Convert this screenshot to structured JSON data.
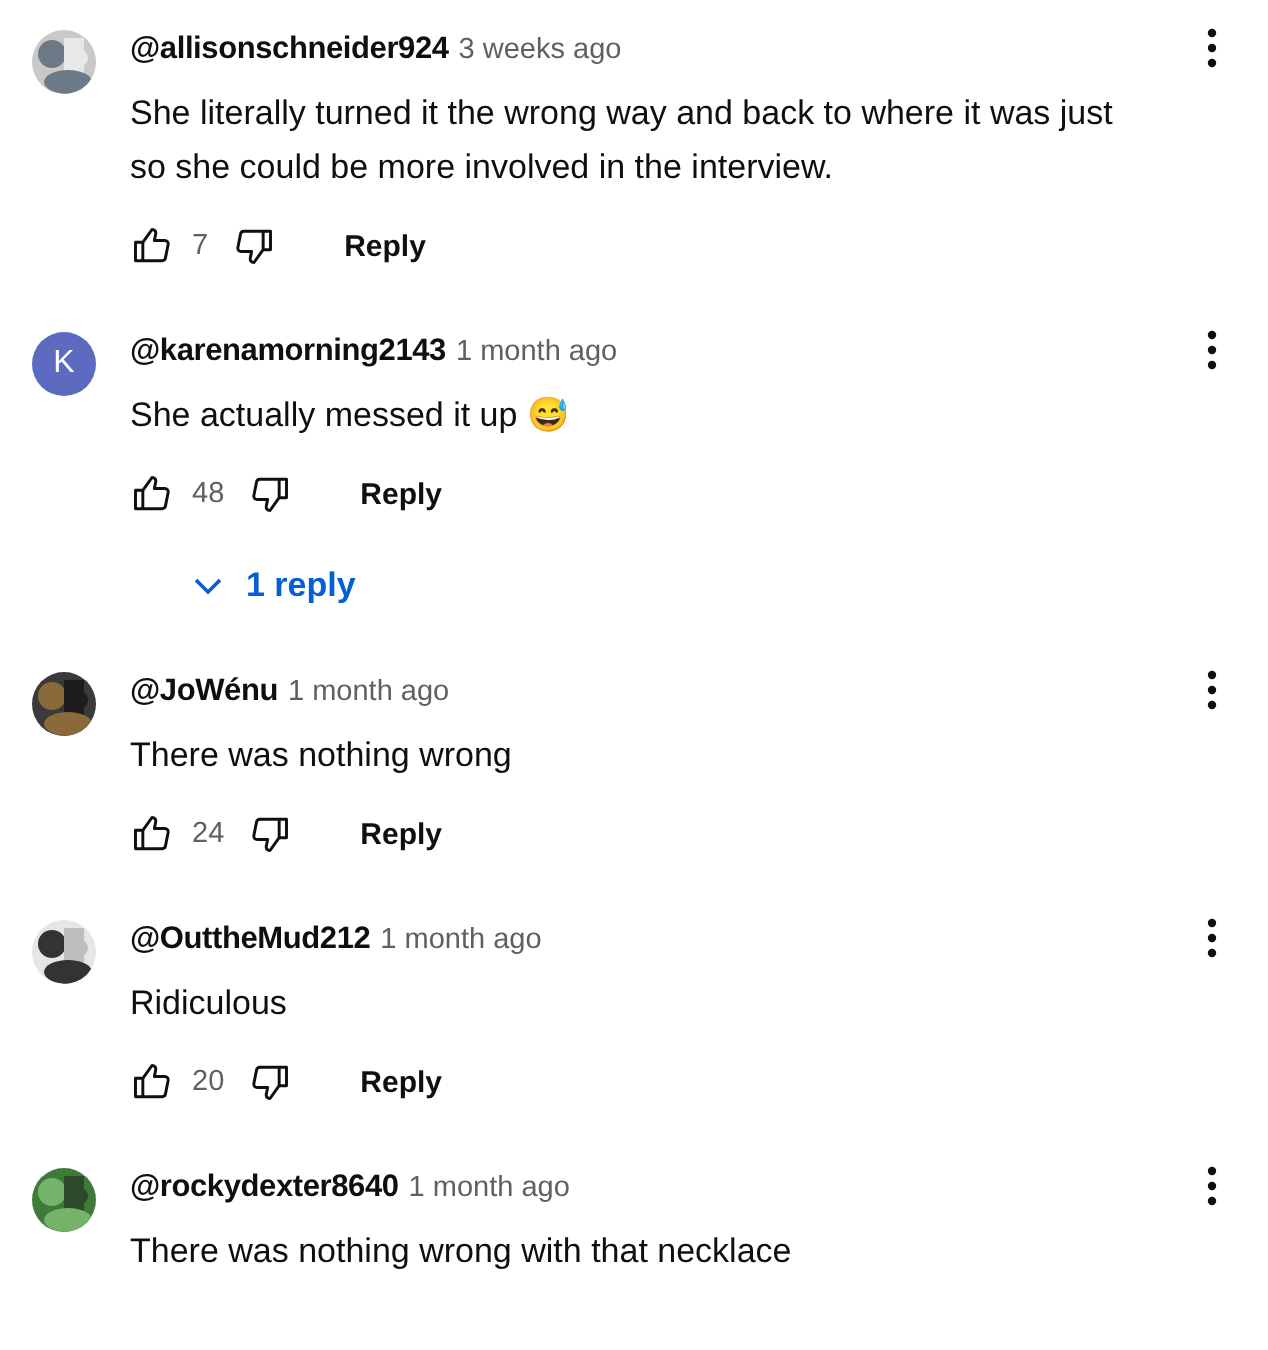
{
  "comments": [
    {
      "author": "@allisonschneider924",
      "time": "3 weeks ago",
      "text": "She literally turned it the wrong way and back to where it was just so she could be more involved in the interview.",
      "likes": "7",
      "reply_label": "Reply"
    },
    {
      "author": "@karenamorning2143",
      "time": "1 month ago",
      "text": "She actually messed it up 😅",
      "avatar": {
        "kind": "letter",
        "letter": "K",
        "color": "#5c6bc0"
      },
      "likes": "48",
      "reply_label": "Reply",
      "replies": "1 reply"
    },
    {
      "author": "@JoWénu",
      "time": "1 month ago",
      "text": "There was nothing wrong",
      "likes": "24",
      "reply_label": "Reply"
    },
    {
      "author": "@OuttheMud212",
      "time": "1 month ago",
      "text": "Ridiculous",
      "likes": "20",
      "reply_label": "Reply"
    },
    {
      "author": "@rockydexter8640",
      "time": "1 month ago",
      "text": "There was nothing wrong with that necklace"
    }
  ]
}
